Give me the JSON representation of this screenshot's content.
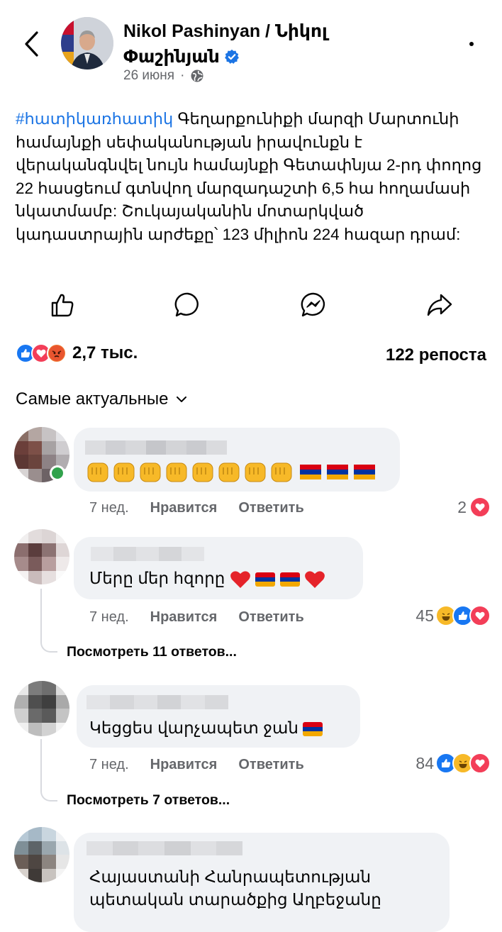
{
  "header": {
    "page_name": "Nikol Pashinyan / Նիկոլ Փաշինյան",
    "date": "26 июня",
    "privacy_icon": "globe-icon",
    "back_icon": "chevron-left-icon",
    "more_icon": "more-horizontal-icon"
  },
  "post": {
    "hashtag": "#հատիկառհատիկ",
    "text": " Գեղարքունիքի մարզի Մարտունի համայնքի սեփականության իրավունքն է վերականգնվել նույն համայնքի Գետափնյա 2-րդ փողոց 22 հասցեում գտնվող մարզադաշտի 6,5 հա հողամասի նկատմամբ: Շուկայականին մոտարկված կադաստրային արժեքը՝ 123 միլիոն 224 հազար դրամ:"
  },
  "actions": [
    "like-icon",
    "comment-icon",
    "messenger-icon",
    "share-icon"
  ],
  "summary": {
    "reaction_count": "2,7 тыс.",
    "reposts": "122 репоста",
    "reaction_icons": [
      "like",
      "love",
      "angry"
    ]
  },
  "sort": {
    "label": "Самые актуальные"
  },
  "comments": [
    {
      "text": "",
      "emojis": "8 fists + 3 armenian flags",
      "age": "7 нед.",
      "like_label": "Нравится",
      "reply_label": "Ответить",
      "count": "2",
      "reactions": [
        "love"
      ]
    },
    {
      "text": "Մերը մեր հզորը",
      "age": "7 нед.",
      "like_label": "Нравится",
      "reply_label": "Ответить",
      "count": "45",
      "reactions": [
        "haha",
        "like",
        "love"
      ],
      "replies": "Посмотреть 11 ответов..."
    },
    {
      "text": "Կեցցես վարչապետ ջան",
      "age": "7 нед.",
      "like_label": "Нравится",
      "reply_label": "Ответить",
      "count": "84",
      "reactions": [
        "like",
        "haha",
        "love"
      ],
      "replies": "Посмотреть 7 ответов..."
    },
    {
      "text_line1": "Հայաստանի Հանրապետության",
      "text_line2": "պետական տարածքից Աղբեջանը"
    }
  ],
  "colors": {
    "link": "#1b74e4",
    "muted": "#65676b",
    "bubble": "#f0f2f5",
    "online": "#31a24c"
  }
}
